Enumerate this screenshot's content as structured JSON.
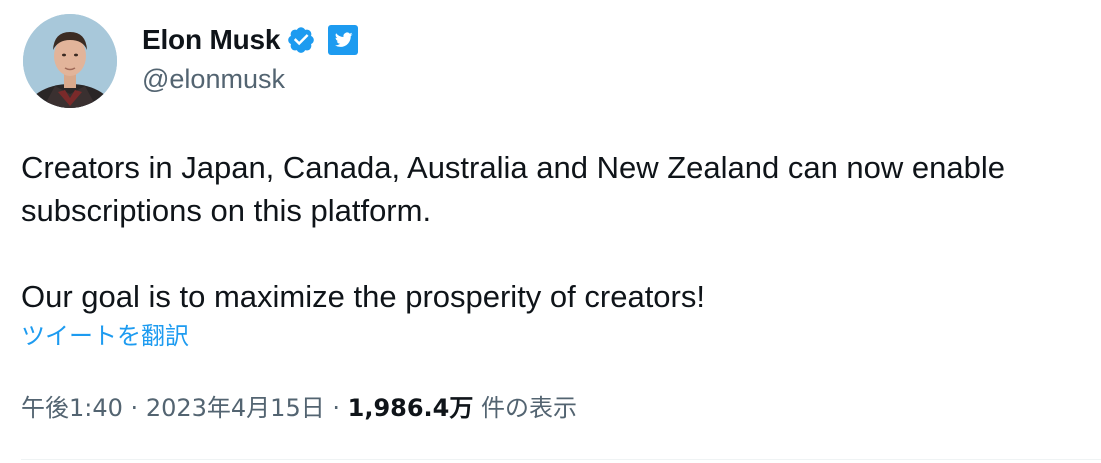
{
  "author": {
    "display_name": "Elon Musk",
    "handle": "@elonmusk",
    "avatar_icon": "profile-photo",
    "verified_icon": "verified-badge-icon",
    "brand_icon": "twitter-bird-icon",
    "verified_color": "#1d9bf0",
    "brand_color": "#1d9bf0"
  },
  "tweet": {
    "paragraphs": [
      "Creators in Japan, Canada, Australia and New Zealand can now enable",
      "subscriptions on this platform.",
      "Our goal is to maximize the prosperity of creators!"
    ],
    "translate_label": "ツイートを翻訳"
  },
  "meta": {
    "time": "午後1:40",
    "separator": "·",
    "date": "2023年4月15日",
    "views_count": "1,986.4万",
    "views_label": "件の表示"
  },
  "colors": {
    "text": "#0f1419",
    "secondary": "#536471",
    "link": "#1d9bf0"
  }
}
